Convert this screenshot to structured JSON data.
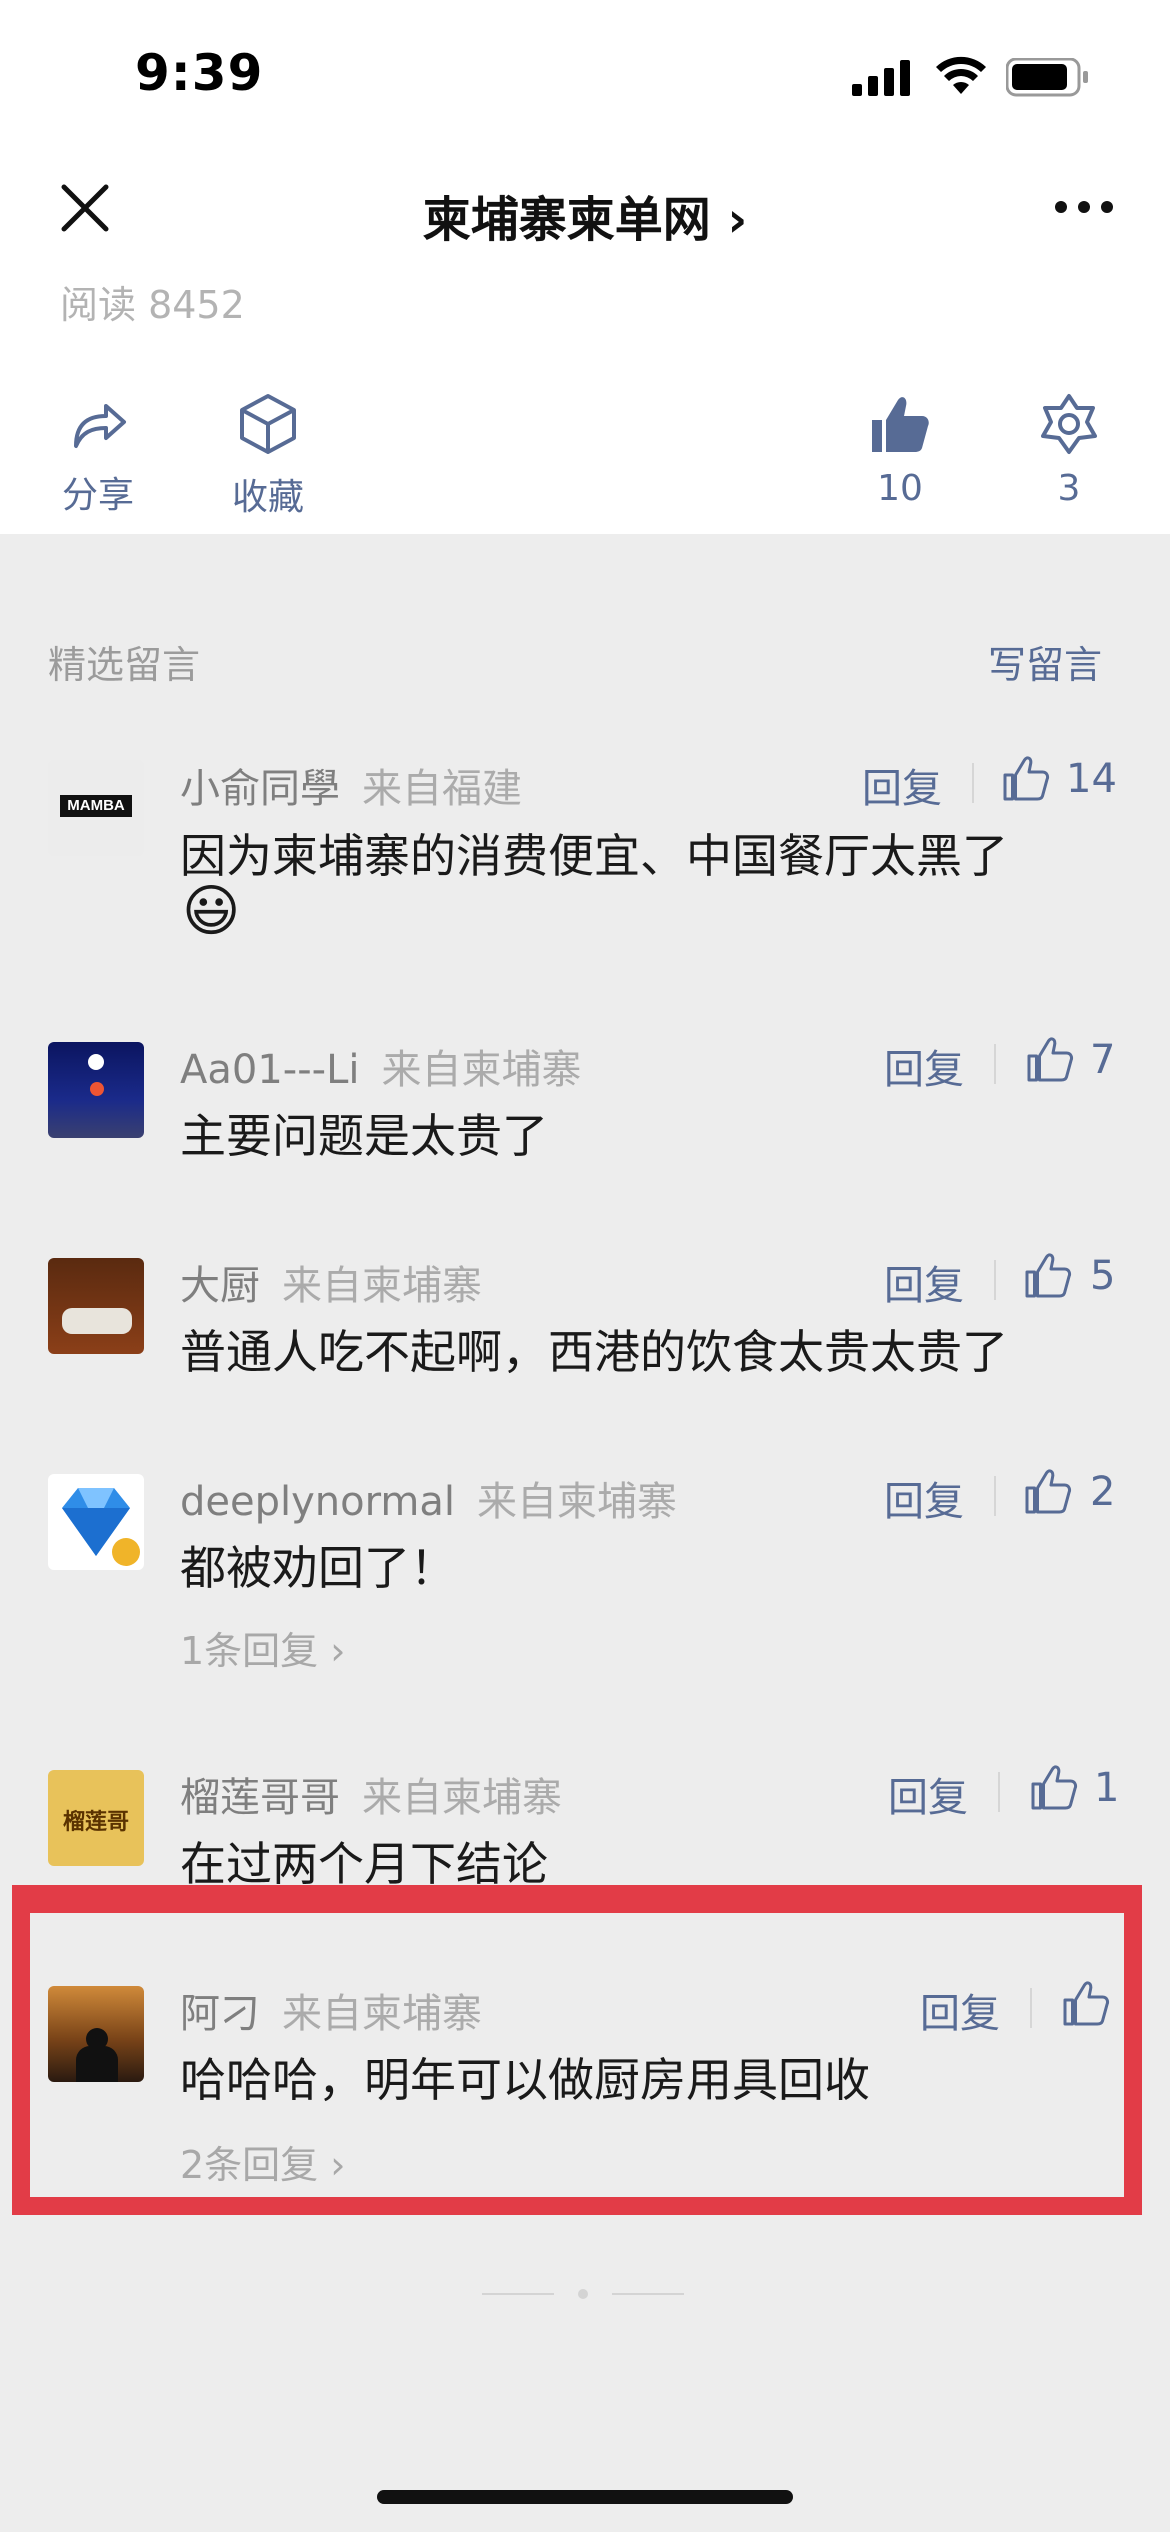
{
  "status_bar": {
    "time": "9:39"
  },
  "nav": {
    "title": "柬埔寨柬单网 ›"
  },
  "article": {
    "reads": "阅读 8452",
    "share_label": "分享",
    "collect_label": "收藏",
    "like_count": "10",
    "wow_count": "3"
  },
  "comments_section": {
    "title": "精选留言",
    "write_label": "写留言",
    "reply_label": "回复",
    "items": [
      {
        "user": "小俞同學",
        "location": "来自福建",
        "text_line1": "因为柬埔寨的消费便宜、中国餐厅太黑了",
        "emoji": "😃",
        "likes": "14"
      },
      {
        "user": "Aa01---Li",
        "location": "来自柬埔寨",
        "text_line1": "主要问题是太贵了",
        "likes": "7"
      },
      {
        "user": "大厨",
        "location": "来自柬埔寨",
        "text_line1": "普通人吃不起啊，西港的饮食太贵太贵了",
        "likes": "5"
      },
      {
        "user": "deeplynormal",
        "location": "来自柬埔寨",
        "text_line1": "都被劝回了！",
        "likes": "2",
        "more": "1条回复 ›"
      },
      {
        "user": "榴莲哥哥",
        "location": "来自柬埔寨",
        "text_line1": "在过两个月下结论",
        "likes": "1"
      },
      {
        "user": "阿刁",
        "location": "来自柬埔寨",
        "text_line1": "哈哈哈，明年可以做厨房用具回收",
        "likes": "",
        "more": "2条回复 ›"
      }
    ]
  },
  "avatars": {
    "mamba_text": "MAMBA",
    "durian_text": "榴莲哥"
  }
}
